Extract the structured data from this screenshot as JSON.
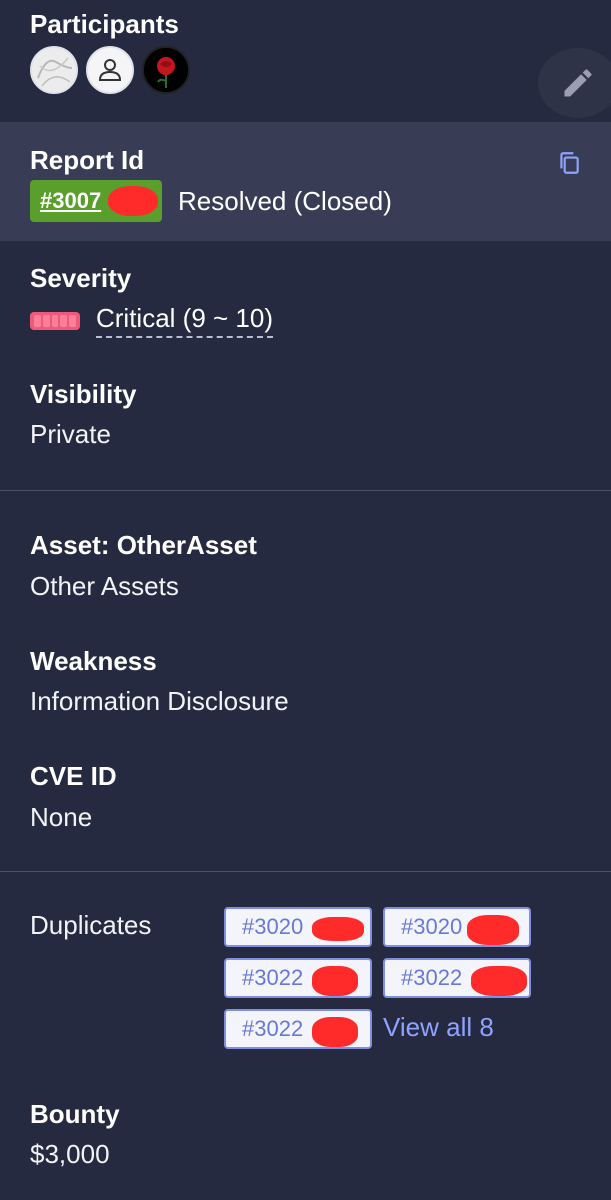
{
  "participants": {
    "label": "Participants",
    "avatars": [
      "avatar-sketch",
      "avatar-default-person",
      "avatar-rose"
    ]
  },
  "edit_icon": "pencil-icon",
  "report": {
    "label": "Report Id",
    "id_text": "#3007",
    "status": "Resolved (Closed)",
    "copy_icon": "copy-icon",
    "pill_color": "#5a9e2c"
  },
  "severity": {
    "label": "Severity",
    "value": "Critical (9 ~ 10)",
    "bar_color": "#f05a7a"
  },
  "visibility": {
    "label": "Visibility",
    "value": "Private"
  },
  "asset": {
    "label": "Asset: OtherAsset",
    "value": "Other Assets"
  },
  "weakness": {
    "label": "Weakness",
    "value": "Information Disclosure"
  },
  "cve": {
    "label": "CVE ID",
    "value": "None"
  },
  "duplicates": {
    "label": "Duplicates",
    "items": [
      "#3020",
      "#3020",
      "#3022",
      "#3022",
      "#3022"
    ],
    "view_all": "View all 8"
  },
  "bounty": {
    "label": "Bounty",
    "value": "$3,000"
  }
}
